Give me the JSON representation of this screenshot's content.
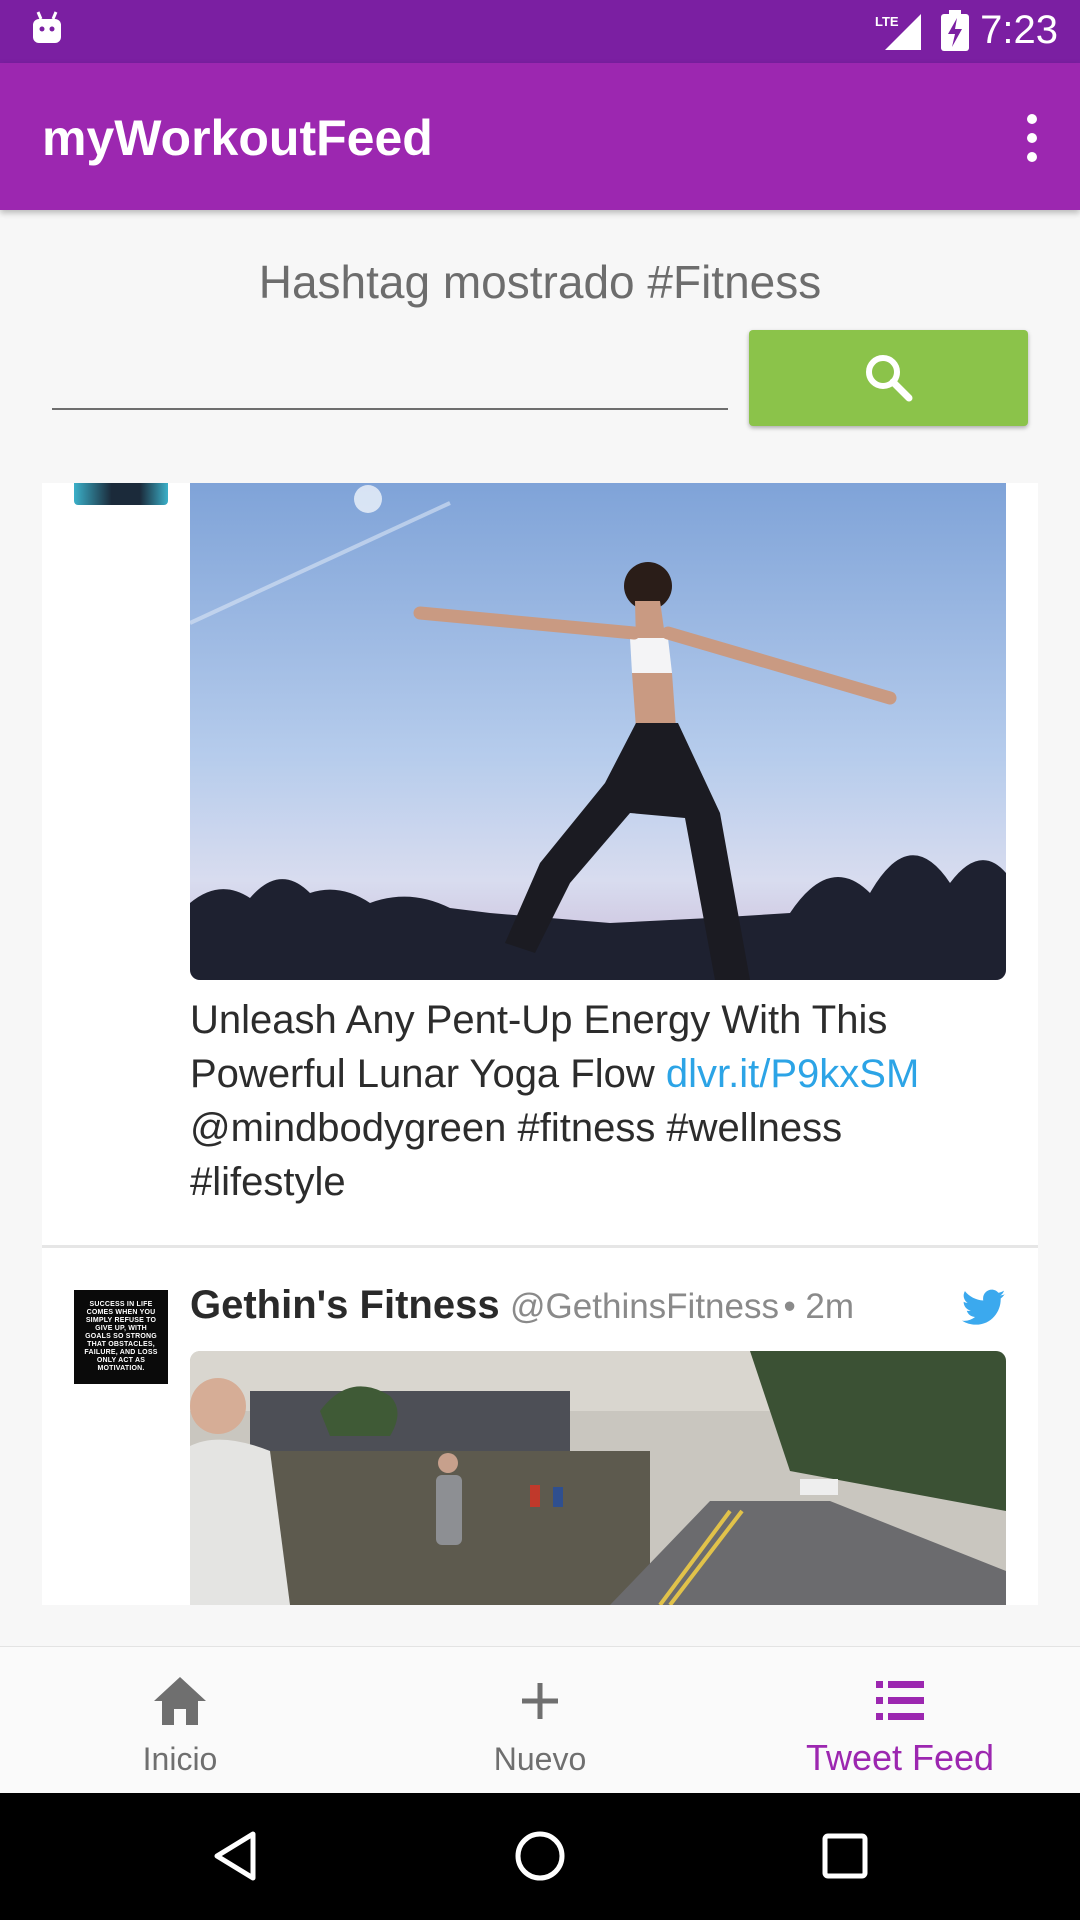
{
  "status_bar": {
    "time": "7:23",
    "network_label": "LTE"
  },
  "app_bar": {
    "title": "myWorkoutFeed",
    "menu_icon": "more-vert-icon"
  },
  "search": {
    "hashtag_label": "Hashtag mostrado #Fitness",
    "input_value": "",
    "placeholder": "",
    "button_icon": "search-icon",
    "button_color": "#8bc34a"
  },
  "feed": {
    "tweets": [
      {
        "text_before_link": "Unleash Any Pent-Up Energy With This Powerful Lunar Yoga Flow ",
        "link": "dlvr.it/P9kxSM",
        "text_after_link": " @mindbodygreen #fitness #wellness #lifestyle"
      },
      {
        "author_name": "Gethin's Fitness",
        "author_handle": "@GethinsFitness",
        "time": "• 2m",
        "avatar_text": "SUCCESS IN LIFE COMES WHEN YOU SIMPLY REFUSE TO GIVE UP, WITH GOALS SO STRONG THAT OBSTACLES, FAILURE, AND LOSS ONLY ACT AS MOTIVATION."
      }
    ]
  },
  "bottom_nav": {
    "items": [
      {
        "label": "Inicio",
        "icon": "home-icon"
      },
      {
        "label": "Nuevo",
        "icon": "plus-icon"
      },
      {
        "label": "Tweet Feed",
        "icon": "list-icon"
      }
    ],
    "active_index": 2,
    "active_color": "#9c27b0"
  },
  "colors": {
    "status_bar": "#7b1fa2",
    "app_bar": "#9c27b0",
    "link": "#2ca4e6",
    "twitter": "#1da1f2"
  }
}
